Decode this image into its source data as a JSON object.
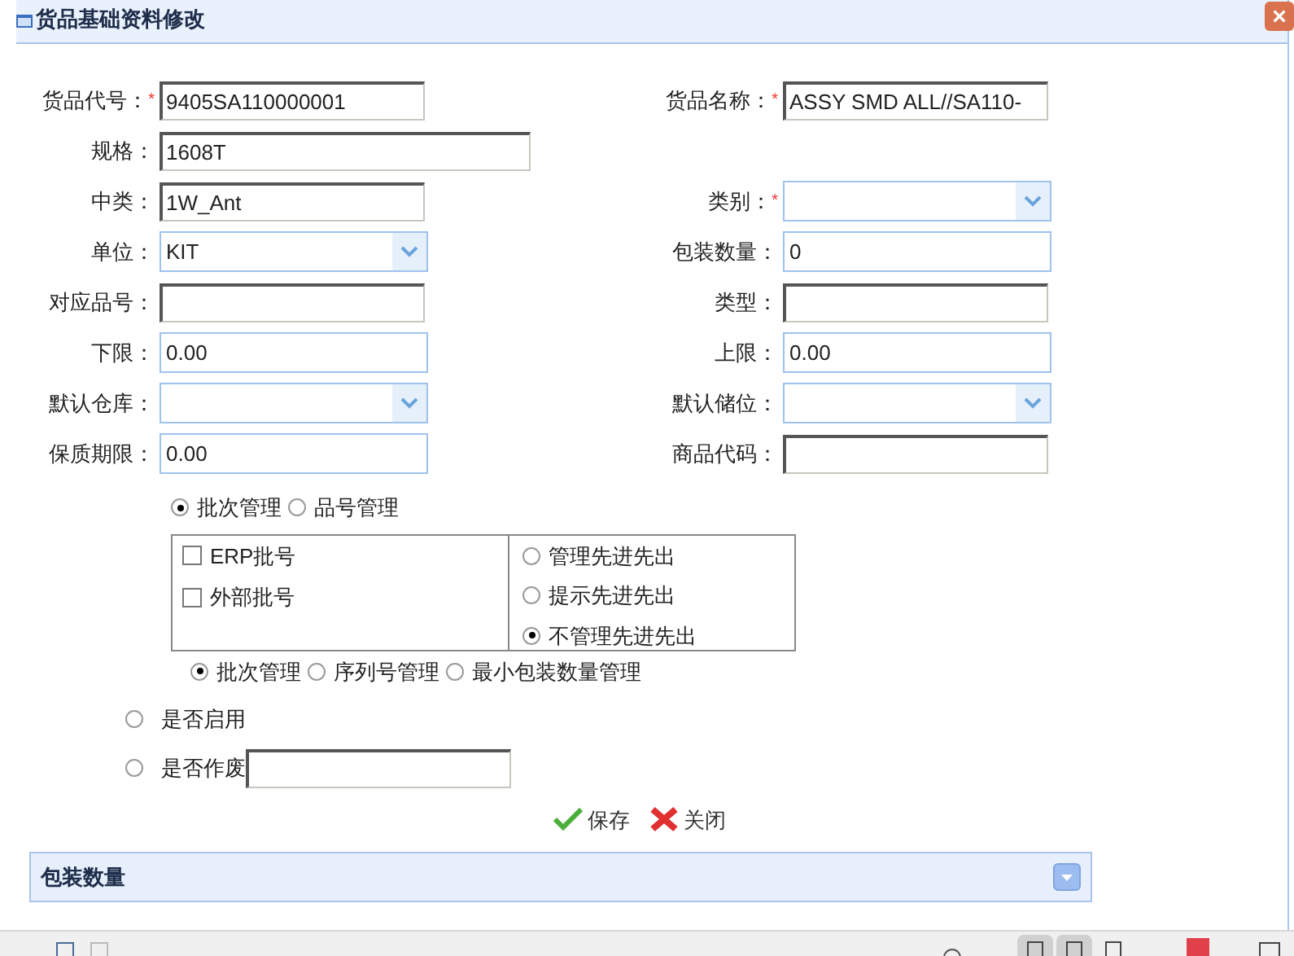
{
  "window": {
    "title": "货品基础资料修改",
    "close": "×"
  },
  "rows": [
    {
      "left": {
        "label": "货品代号：",
        "required_mark": "*",
        "kind": "text",
        "value": "9405SA110000001"
      },
      "right": {
        "label": "货品名称：",
        "required_mark": "*",
        "kind": "text",
        "value": "ASSY SMD ALL//SA110-"
      }
    },
    {
      "left": {
        "label": "规格：",
        "kind": "wide",
        "value": "1608T"
      }
    },
    {
      "left": {
        "label": "中类：",
        "kind": "text",
        "value": "1W_Ant"
      },
      "right": {
        "label": "类别：",
        "required_mark": "*",
        "kind": "select"
      }
    },
    {
      "left": {
        "label": "单位：",
        "kind": "select",
        "value": "KIT"
      },
      "right": {
        "label": "包装数量：",
        "kind": "numeric",
        "value": "0"
      }
    },
    {
      "left": {
        "label": "对应品号：",
        "kind": "text"
      },
      "right": {
        "label": "类型：",
        "kind": "text"
      }
    },
    {
      "left": {
        "label": "下限：",
        "kind": "numeric",
        "value": "0.00"
      },
      "right": {
        "label": "上限：",
        "kind": "numeric",
        "value": "0.00"
      }
    },
    {
      "left": {
        "label": "默认仓库：",
        "kind": "select"
      },
      "right": {
        "label": "默认储位：",
        "kind": "select"
      }
    },
    {
      "left": {
        "label": "保质期限：",
        "kind": "numeric",
        "value": "0.00"
      },
      "right": {
        "label": "商品代码：",
        "kind": "text"
      }
    }
  ],
  "management_mode": [
    {
      "label": "批次管理",
      "selected": true
    },
    {
      "label": "品号管理",
      "selected": false
    }
  ],
  "batch_options": [
    {
      "label": "ERP批号",
      "checked": false
    },
    {
      "label": "外部批号",
      "checked": false
    }
  ],
  "fifo_options": [
    {
      "label": "管理先进先出",
      "selected": false
    },
    {
      "label": "提示先进先出",
      "selected": false
    },
    {
      "label": "不管理先进先出",
      "selected": true
    }
  ],
  "tracking_mode": [
    {
      "label": "批次管理",
      "selected": true
    },
    {
      "label": "序列号管理",
      "selected": false
    },
    {
      "label": "最小包装数量管理",
      "selected": false
    }
  ],
  "enabled": {
    "label": "是否启用",
    "selected": false
  },
  "void": {
    "label": "是否作废",
    "selected": false
  },
  "buttons": [
    {
      "kind": "save",
      "label": "保存"
    },
    {
      "kind": "close",
      "label": "关闭"
    }
  ],
  "panel": {
    "title": "包装数量",
    "expanded": false
  },
  "view_buttons": [
    {
      "selected": true
    },
    {
      "selected": true
    },
    {
      "selected": false
    }
  ]
}
